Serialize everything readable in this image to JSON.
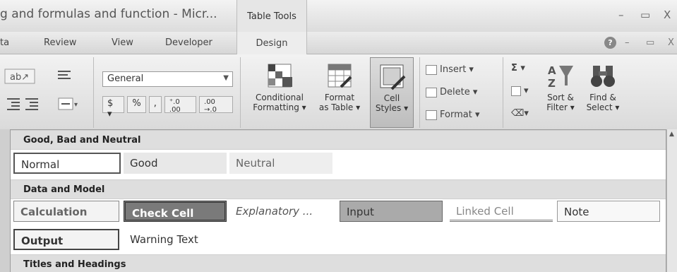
{
  "window": {
    "title": "g and formulas and function - Micr...",
    "context_tab": "Table Tools",
    "minimize": "–",
    "restore": "▭",
    "close": "X"
  },
  "tabs": [
    "ta",
    "Review",
    "View",
    "Developer",
    "Design"
  ],
  "ribbon": {
    "number_format": "General",
    "number_buttons": [
      "$ ▾",
      "%",
      ",",
      "⁺.0 .00",
      ".00 →.0"
    ],
    "conditional_formatting": [
      "Conditional",
      "Formatting ▾"
    ],
    "format_as_table": [
      "Format",
      "as Table ▾"
    ],
    "cell_styles": [
      "Cell",
      "Styles ▾"
    ],
    "insert": "Insert ▾",
    "delete": "Delete ▾",
    "format": "Format ▾",
    "sort_filter": [
      "Sort &",
      "Filter ▾"
    ],
    "find_select": [
      "Find &",
      "Select ▾"
    ],
    "sum_symbol": "Σ ▾",
    "fill_symbol": "▾",
    "clear_symbol": "▾"
  },
  "gallery": {
    "sections": [
      {
        "title": "Good, Bad and Neutral",
        "styles": [
          "Normal",
          "Good",
          "Neutral"
        ]
      },
      {
        "title": "Data and Model",
        "styles": [
          "Calculation",
          "Check Cell",
          "Explanatory ...",
          "Input",
          "Linked Cell",
          "Note",
          "Output",
          "Warning Text"
        ]
      },
      {
        "title": "Titles and Headings",
        "styles": []
      }
    ]
  }
}
